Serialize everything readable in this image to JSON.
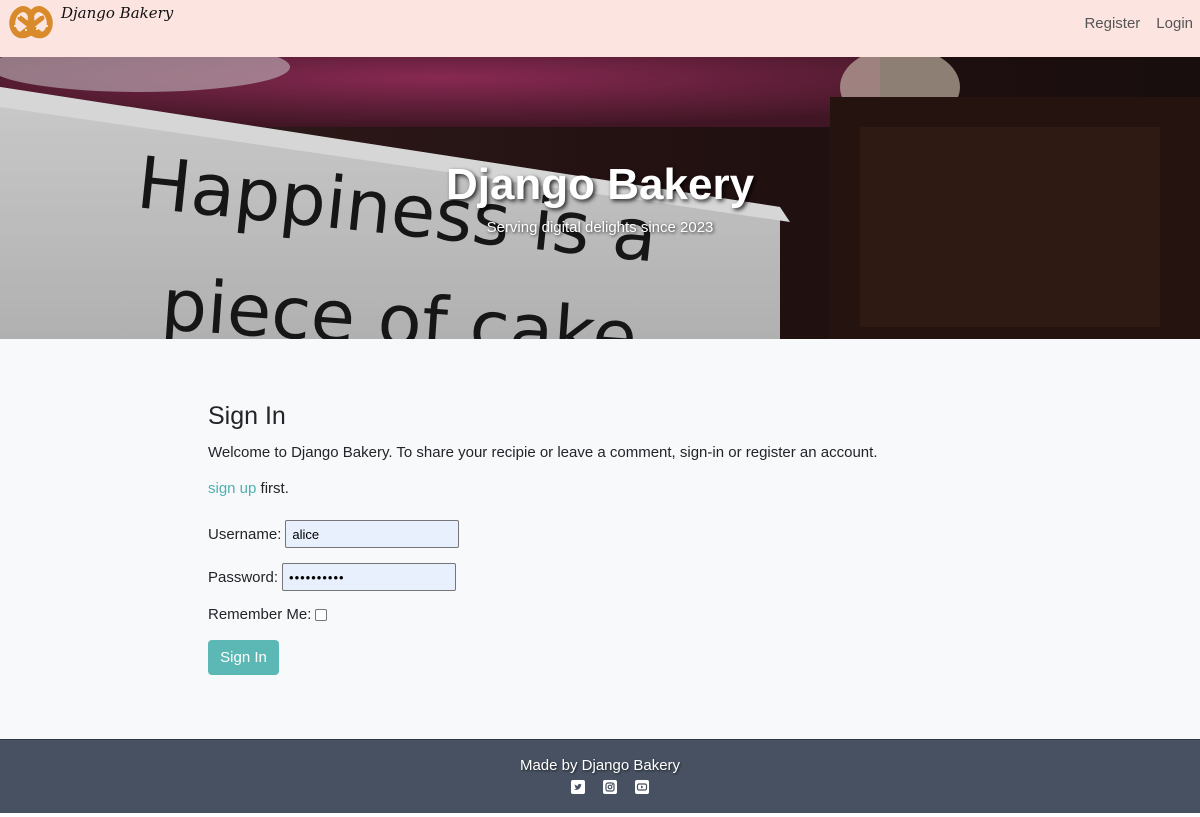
{
  "navbar": {
    "brand": "Django Bakery",
    "links": [
      {
        "label": "Register"
      },
      {
        "label": "Login"
      }
    ]
  },
  "hero": {
    "title": "Django Bakery",
    "subtitle": "Serving digital delights since 2023",
    "image_text": [
      "Happiness is a",
      "piece of cake"
    ]
  },
  "main": {
    "title": "Sign In",
    "welcome": "Welcome to Django Bakery. To share your recipie or leave a comment, sign-in or register an account.",
    "signup_link": "sign up",
    "signup_suffix": " first.",
    "form": {
      "username_label": "Username:",
      "username_value": "alice",
      "password_label": "Password:",
      "password_value": "••••••••••",
      "remember_label": "Remember Me:",
      "remember_checked": false,
      "submit_label": "Sign In"
    }
  },
  "footer": {
    "text": "Made by Django Bakery",
    "social": [
      "twitter-icon",
      "instagram-icon",
      "youtube-icon"
    ]
  },
  "colors": {
    "navbar_bg": "#fce4e1",
    "accent": "#5bb8b5",
    "link": "#4fb0b0",
    "footer_bg": "#475161"
  }
}
